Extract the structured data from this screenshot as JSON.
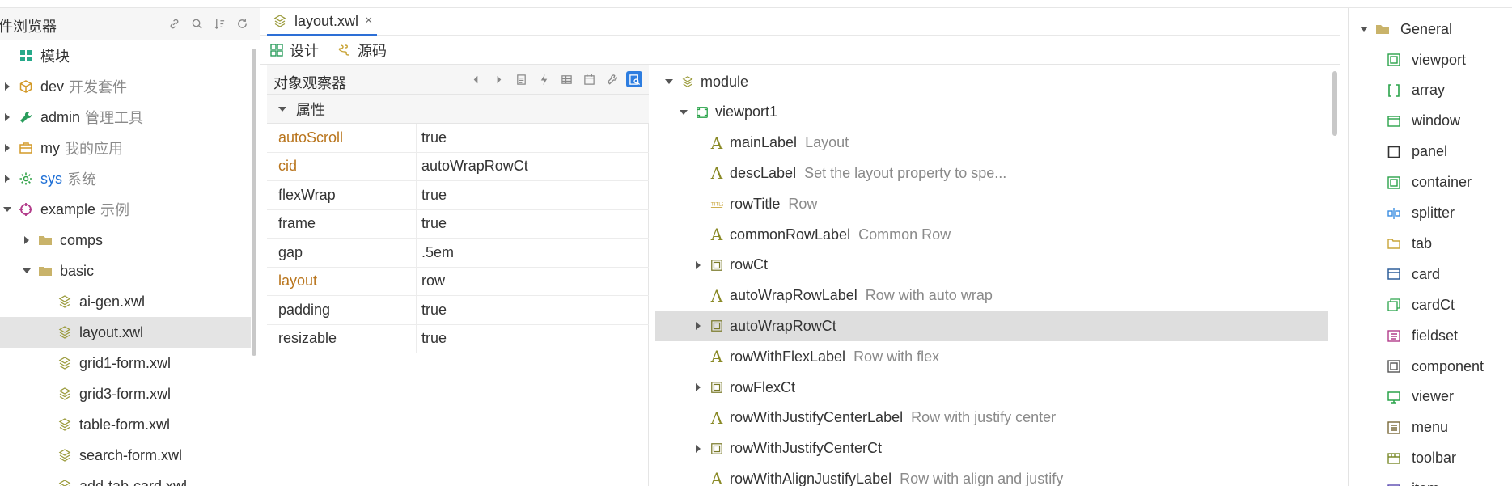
{
  "left": {
    "title": "件浏览器",
    "tree": [
      {
        "label": "模块",
        "sub": "",
        "icon": "modules-icon",
        "depth": 0,
        "arrow": "none",
        "color": "#26a98a"
      },
      {
        "label": "dev",
        "sub": "开发套件",
        "icon": "package-icon",
        "depth": 0,
        "arrow": "right",
        "color": "#d39a29"
      },
      {
        "label": "admin",
        "sub": "管理工具",
        "icon": "wrench-icon",
        "depth": 0,
        "arrow": "right",
        "color": "#2a9d5c"
      },
      {
        "label": "my",
        "sub": "我的应用",
        "icon": "briefcase-icon",
        "depth": 0,
        "arrow": "right",
        "color": "#d39a29"
      },
      {
        "label": "sys",
        "sub": "系统",
        "icon": "gear-icon",
        "depth": 0,
        "arrow": "right",
        "color": "#33a34a",
        "blue": true
      },
      {
        "label": "example",
        "sub": "示例",
        "icon": "example-icon",
        "depth": 0,
        "arrow": "down",
        "color": "#b23b8a"
      },
      {
        "label": "comps",
        "sub": "",
        "icon": "folder-icon",
        "depth": 1,
        "arrow": "right",
        "color": "#c9b36a"
      },
      {
        "label": "basic",
        "sub": "",
        "icon": "folder-icon",
        "depth": 1,
        "arrow": "down",
        "color": "#c9b36a"
      },
      {
        "label": "ai-gen.xwl",
        "sub": "",
        "icon": "xwl-file-icon",
        "depth": 2,
        "arrow": "none",
        "color": "#9a9a3a"
      },
      {
        "label": "layout.xwl",
        "sub": "",
        "icon": "xwl-file-icon",
        "depth": 2,
        "arrow": "none",
        "color": "#9a9a3a",
        "selected": true
      },
      {
        "label": "grid1-form.xwl",
        "sub": "",
        "icon": "xwl-file-icon",
        "depth": 2,
        "arrow": "none",
        "color": "#9a9a3a"
      },
      {
        "label": "grid3-form.xwl",
        "sub": "",
        "icon": "xwl-file-icon",
        "depth": 2,
        "arrow": "none",
        "color": "#9a9a3a"
      },
      {
        "label": "table-form.xwl",
        "sub": "",
        "icon": "xwl-file-icon",
        "depth": 2,
        "arrow": "none",
        "color": "#9a9a3a"
      },
      {
        "label": "search-form.xwl",
        "sub": "",
        "icon": "xwl-file-icon",
        "depth": 2,
        "arrow": "none",
        "color": "#9a9a3a"
      },
      {
        "label": "add-tab-card.xwl",
        "sub": "",
        "icon": "xwl-file-icon",
        "depth": 2,
        "arrow": "none",
        "color": "#9a9a3a"
      }
    ]
  },
  "doc_tab": {
    "label": "layout.xwl",
    "close": "×"
  },
  "sub_tabs": [
    {
      "label": "设计",
      "icon": "design-icon"
    },
    {
      "label": "源码",
      "icon": "source-icon"
    }
  ],
  "inspector": {
    "title": "对象观察器",
    "section": "属性",
    "props": [
      {
        "key": "autoScroll",
        "value": "true",
        "modified": true
      },
      {
        "key": "cid",
        "value": "autoWrapRowCt",
        "modified": true
      },
      {
        "key": "flexWrap",
        "value": "true",
        "modified": false
      },
      {
        "key": "frame",
        "value": "true",
        "modified": false
      },
      {
        "key": "gap",
        "value": ".5em",
        "modified": false
      },
      {
        "key": "layout",
        "value": "row",
        "modified": true
      },
      {
        "key": "padding",
        "value": "true",
        "modified": false
      },
      {
        "key": "resizable",
        "value": "true",
        "modified": false
      }
    ]
  },
  "design": {
    "rows": [
      {
        "label": "module",
        "sub": "",
        "icon": "module-icon",
        "depth": 0,
        "arrow": "down"
      },
      {
        "label": "viewport1",
        "sub": "",
        "icon": "viewport-icon",
        "depth": 1,
        "arrow": "down"
      },
      {
        "label": "mainLabel",
        "sub": "Layout",
        "icon": "label-icon",
        "depth": 2,
        "arrow": "none"
      },
      {
        "label": "descLabel",
        "sub": "Set the layout property to spe...",
        "icon": "label-icon",
        "depth": 2,
        "arrow": "none"
      },
      {
        "label": "rowTitle",
        "sub": "Row",
        "icon": "title-icon",
        "depth": 2,
        "arrow": "none"
      },
      {
        "label": "commonRowLabel",
        "sub": "Common Row",
        "icon": "label-icon",
        "depth": 2,
        "arrow": "none"
      },
      {
        "label": "rowCt",
        "sub": "",
        "icon": "container-icon",
        "depth": 2,
        "arrow": "right"
      },
      {
        "label": "autoWrapRowLabel",
        "sub": "Row with auto wrap",
        "icon": "label-icon",
        "depth": 2,
        "arrow": "none"
      },
      {
        "label": "autoWrapRowCt",
        "sub": "",
        "icon": "container-icon",
        "depth": 2,
        "arrow": "right",
        "selected": true
      },
      {
        "label": "rowWithFlexLabel",
        "sub": "Row with flex",
        "icon": "label-icon",
        "depth": 2,
        "arrow": "none"
      },
      {
        "label": "rowFlexCt",
        "sub": "",
        "icon": "container-icon",
        "depth": 2,
        "arrow": "right"
      },
      {
        "label": "rowWithJustifyCenterLabel",
        "sub": "Row with justify center",
        "icon": "label-icon",
        "depth": 2,
        "arrow": "none"
      },
      {
        "label": "rowWithJustifyCenterCt",
        "sub": "",
        "icon": "container-icon",
        "depth": 2,
        "arrow": "right"
      },
      {
        "label": "rowWithAlignJustifyLabel",
        "sub": "Row with align and justify",
        "icon": "label-icon",
        "depth": 2,
        "arrow": "none"
      }
    ]
  },
  "palette": {
    "group": "General",
    "items": [
      {
        "label": "viewport",
        "icon": "viewport-icon",
        "color": "#2aa34a"
      },
      {
        "label": "array",
        "icon": "array-icon",
        "color": "#2aa34a"
      },
      {
        "label": "window",
        "icon": "window-icon",
        "color": "#2aa34a"
      },
      {
        "label": "panel",
        "icon": "panel-icon",
        "color": "#333333"
      },
      {
        "label": "container",
        "icon": "container-icon",
        "color": "#2aa34a"
      },
      {
        "label": "splitter",
        "icon": "splitter-icon",
        "color": "#3a8de0"
      },
      {
        "label": "tab",
        "icon": "tab-icon",
        "color": "#c9a53a"
      },
      {
        "label": "card",
        "icon": "card-icon",
        "color": "#2e5f9a"
      },
      {
        "label": "cardCt",
        "icon": "card-container-icon",
        "color": "#2aa34a"
      },
      {
        "label": "fieldset",
        "icon": "fieldset-icon",
        "color": "#b23b8a"
      },
      {
        "label": "component",
        "icon": "component-icon",
        "color": "#555555"
      },
      {
        "label": "viewer",
        "icon": "viewer-icon",
        "color": "#2aa34a"
      },
      {
        "label": "menu",
        "icon": "menu-icon",
        "color": "#7a6a3a"
      },
      {
        "label": "toolbar",
        "icon": "toolbar-icon",
        "color": "#7a8a2a"
      },
      {
        "label": "item",
        "icon": "item-icon",
        "color": "#5a4ab0"
      }
    ]
  }
}
